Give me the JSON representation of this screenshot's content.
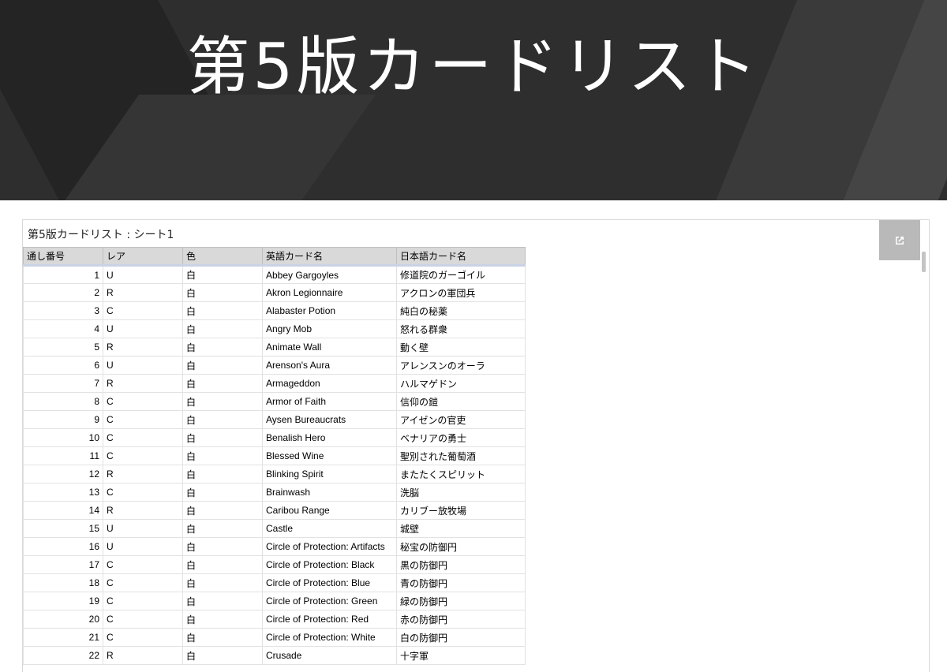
{
  "hero": {
    "title": "第5版カードリスト"
  },
  "sheet": {
    "title": "第5版カードリスト : シート1",
    "open_icon": "open-in-new-icon"
  },
  "table": {
    "headers": [
      "通し番号",
      "レア",
      "色",
      "英語カード名",
      "日本語カード名"
    ],
    "rows": [
      [
        "1",
        "U",
        "白",
        "Abbey Gargoyles",
        "修道院のガーゴイル"
      ],
      [
        "2",
        "R",
        "白",
        "Akron Legionnaire",
        "アクロンの軍団兵"
      ],
      [
        "3",
        "C",
        "白",
        "Alabaster Potion",
        "純白の秘薬"
      ],
      [
        "4",
        "U",
        "白",
        "Angry Mob",
        "怒れる群衆"
      ],
      [
        "5",
        "R",
        "白",
        "Animate Wall",
        "動く壁"
      ],
      [
        "6",
        "U",
        "白",
        "Arenson's Aura",
        "アレンスンのオーラ"
      ],
      [
        "7",
        "R",
        "白",
        "Armageddon",
        "ハルマゲドン"
      ],
      [
        "8",
        "C",
        "白",
        "Armor of Faith",
        "信仰の鎧"
      ],
      [
        "9",
        "C",
        "白",
        "Aysen Bureaucrats",
        "アイゼンの官吏"
      ],
      [
        "10",
        "C",
        "白",
        "Benalish Hero",
        "ベナリアの勇士"
      ],
      [
        "11",
        "C",
        "白",
        "Blessed Wine",
        "聖別された葡萄酒"
      ],
      [
        "12",
        "R",
        "白",
        "Blinking Spirit",
        "またたくスピリット"
      ],
      [
        "13",
        "C",
        "白",
        "Brainwash",
        "洗脳"
      ],
      [
        "14",
        "R",
        "白",
        "Caribou Range",
        "カリブー放牧場"
      ],
      [
        "15",
        "U",
        "白",
        "Castle",
        "城壁"
      ],
      [
        "16",
        "U",
        "白",
        "Circle of Protection: Artifacts",
        "秘宝の防御円"
      ],
      [
        "17",
        "C",
        "白",
        "Circle of Protection: Black",
        "黒の防御円"
      ],
      [
        "18",
        "C",
        "白",
        "Circle of Protection: Blue",
        "青の防御円"
      ],
      [
        "19",
        "C",
        "白",
        "Circle of Protection: Green",
        "緑の防御円"
      ],
      [
        "20",
        "C",
        "白",
        "Circle of Protection: Red",
        "赤の防御円"
      ],
      [
        "21",
        "C",
        "白",
        "Circle of Protection: White",
        "白の防御円"
      ],
      [
        "22",
        "R",
        "白",
        "Crusade",
        "十字軍"
      ]
    ]
  }
}
